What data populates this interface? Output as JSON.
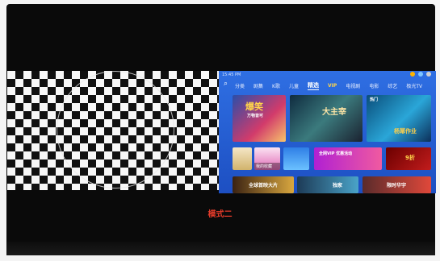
{
  "ui": {
    "status_time": "15:45 PM",
    "nav": {
      "items": [
        "分类",
        "剧集",
        "K歌",
        "儿童",
        "精选",
        "VIP",
        "电视剧",
        "电影",
        "综艺",
        "极光TV"
      ],
      "active_index": 4,
      "vip_index": 5
    },
    "tiles": {
      "a_title": "爆笑",
      "a_sub": "万物皆可",
      "b_title": "大主宰",
      "c_title": "杨幂作业",
      "c_sub": "热门",
      "mid_caption": "我的收藏",
      "banner_text": "全网VIP 优惠活动",
      "right_small": "9折",
      "bottom_left": "全球首映大片",
      "bottom_mid": "独家",
      "bottom_right": "限时华宇"
    }
  },
  "caption": "模式二",
  "colors": {
    "accent": "#2f6fe3",
    "caption": "#e23b2a"
  }
}
